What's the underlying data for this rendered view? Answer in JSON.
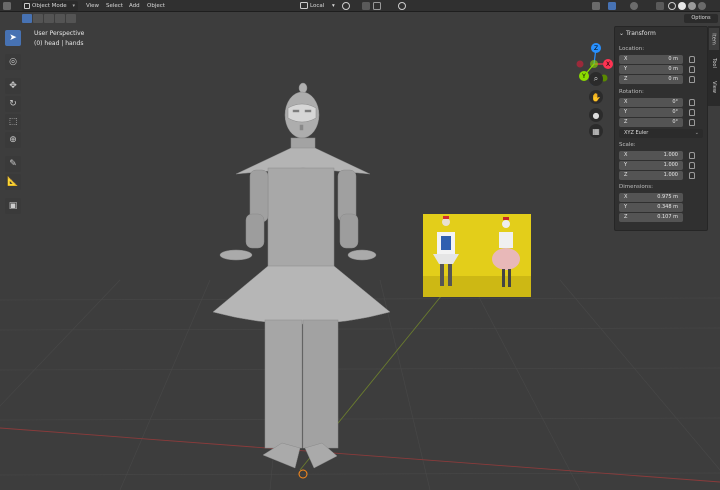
{
  "header": {
    "mode_label": "Object Mode",
    "menu": [
      "View",
      "Select",
      "Add",
      "Object"
    ],
    "orientation": "Local"
  },
  "viewport": {
    "title": "User Perspective",
    "subtitle": "(0) head | hands",
    "options_label": "Options"
  },
  "gizmo": {
    "x_label": "X",
    "y_label": "Y",
    "z_label": "Z"
  },
  "sidebar_tabs": [
    "Item",
    "Tool",
    "View"
  ],
  "transform": {
    "title": "Transform",
    "location": {
      "label": "Location:",
      "x": "0 m",
      "y": "0 m",
      "z": "0 m"
    },
    "rotation": {
      "label": "Rotation:",
      "x": "0°",
      "y": "0°",
      "z": "0°"
    },
    "rotation_mode": "XYZ Euler",
    "scale": {
      "label": "Scale:",
      "x": "1.000",
      "y": "1.000",
      "z": "1.000"
    },
    "dimensions": {
      "label": "Dimensions:",
      "x": "0.975 m",
      "y": "0.348 m",
      "z": "0.107 m"
    },
    "axis": {
      "x": "X",
      "y": "Y",
      "z": "Z"
    }
  },
  "colors": {
    "accent": "#4772b3",
    "x_axis": "#ff3352",
    "y_axis": "#8bdc00",
    "z_axis": "#2890ff",
    "reference_bg": "#e3ce1a"
  },
  "icons": [
    "select-box-icon",
    "cursor-icon",
    "move-icon",
    "rotate-icon",
    "scale-icon",
    "transform-icon",
    "annotate-icon",
    "measure-icon",
    "add-cube-icon",
    "zoom-icon",
    "hand-icon",
    "camera-icon",
    "grid-icon"
  ]
}
